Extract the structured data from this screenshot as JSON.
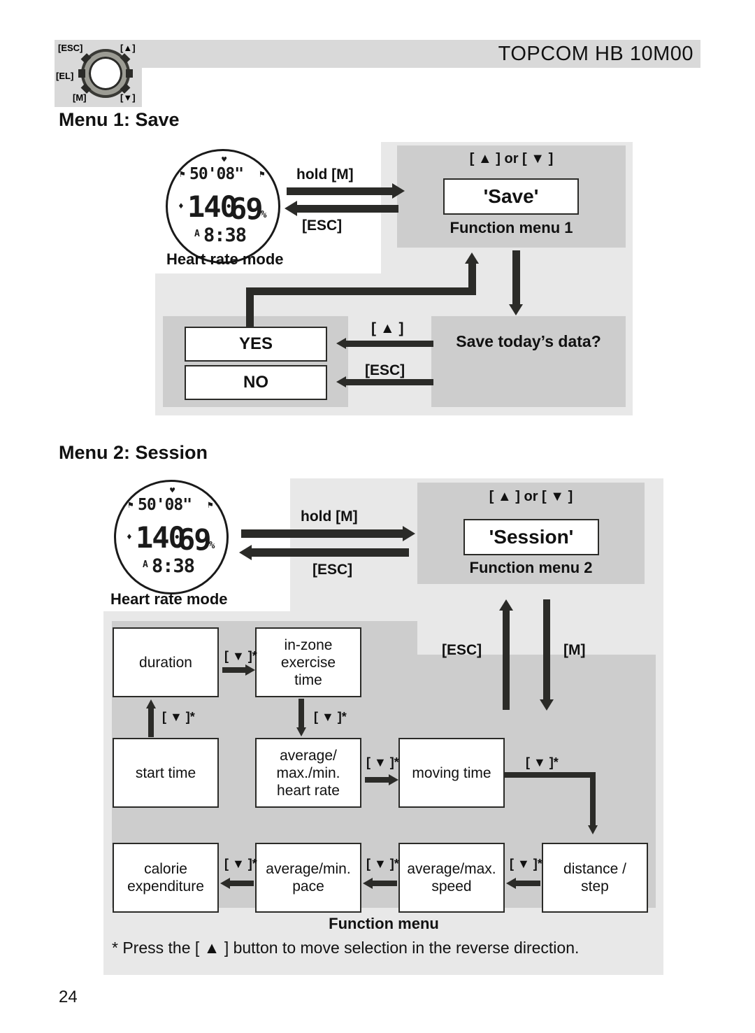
{
  "header": {
    "title": "TOPCOM HB 10M00"
  },
  "watch_keys": {
    "esc": "[ESC]",
    "up": "[▲]",
    "el": "[EL]",
    "m": "[M]",
    "down": "[▼]"
  },
  "watch_face": {
    "heart_icon": "♥",
    "top_line": "50'08\"",
    "main_value": "140",
    "secondary_value": "69",
    "percent": "%",
    "bottom_line": "8:38",
    "bottom_prefix": "A",
    "top_prefix": "⚑",
    "top_suffix": "⚑",
    "mid_prefix": "♦",
    "caption": "Heart rate mode"
  },
  "menu1": {
    "heading": "Menu 1: Save",
    "select_hint": "[ ▲ ] or [ ▼ ]",
    "screen_label": "'Save'",
    "function_menu_label": "Function menu 1",
    "to_menu_key": "hold [M]",
    "back_key": "[ESC]",
    "question": "Save today’s data?",
    "yes_label": "YES",
    "no_label": "NO",
    "yes_key": "[ ▲ ]",
    "no_key": "[ESC]"
  },
  "menu2": {
    "heading": "Menu 2: Session",
    "select_hint": "[ ▲ ] or [ ▼ ]",
    "screen_label": "'Session'",
    "function_menu_label": "Function menu 2",
    "to_menu_key": "hold [M]",
    "back_key": "[ESC]",
    "up_column_key": "[ESC]",
    "down_column_key": "[M]",
    "function_menu_caption": "Function menu",
    "step_key": "[ ▼ ]*",
    "items": [
      {
        "id": "duration",
        "label": "duration"
      },
      {
        "id": "in-zone-exercise-time",
        "label": "in-zone\nexercise\ntime"
      },
      {
        "id": "start-time",
        "label": "start time"
      },
      {
        "id": "average-max-min-heart-rate",
        "label": "average/\nmax./min.\nheart rate"
      },
      {
        "id": "moving-time",
        "label": "moving time"
      },
      {
        "id": "calorie-expenditure",
        "label": "calorie\nexpenditure"
      },
      {
        "id": "average-min-pace",
        "label": "average/min.\npace"
      },
      {
        "id": "average-max-speed",
        "label": "average/max.\nspeed"
      },
      {
        "id": "distance-step",
        "label": "distance /\nstep"
      }
    ]
  },
  "footer": {
    "note": "* Press the [ ▲ ] button to move selection in the reverse direction.",
    "page_number": "24"
  },
  "colors": {
    "panel_light": "#e8e8e8",
    "panel_mid": "#cdcdcd",
    "header_bar": "#d9d9d9",
    "ink": "#2b2b28"
  }
}
